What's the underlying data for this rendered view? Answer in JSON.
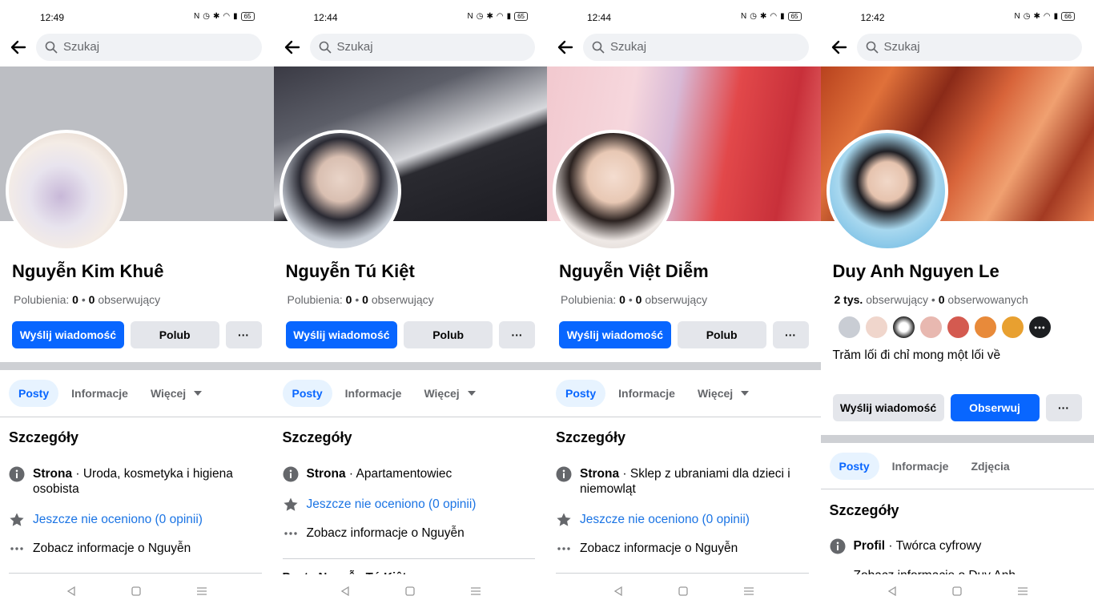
{
  "screens": [
    {
      "time": "12:49",
      "battery": "65",
      "search_placeholder": "Szukaj",
      "name": "Nguyễn Kim Khuê",
      "stats": {
        "label1": "Polubienia:",
        "value1": "0",
        "value2": "0",
        "label2": "obserwujący"
      },
      "buttons": {
        "message": "Wyślij wiadomość",
        "like": "Polub",
        "more": "···"
      },
      "tabs": [
        "Posty",
        "Informacje",
        "Więcej"
      ],
      "details_title": "Szczegóły",
      "details": {
        "category_label": "Strona",
        "category_value": " · Uroda, kosmetyka i higiena osobista",
        "rating": "Jeszcze nie oceniono (0 opinii)",
        "info": "Zobacz informacje o Nguyễn"
      }
    },
    {
      "time": "12:44",
      "battery": "65",
      "search_placeholder": "Szukaj",
      "name": "Nguyễn Tú Kiệt",
      "stats": {
        "label1": "Polubienia:",
        "value1": "0",
        "value2": "0",
        "label2": "obserwujący"
      },
      "buttons": {
        "message": "Wyślij wiadomość",
        "like": "Polub",
        "more": "···"
      },
      "tabs": [
        "Posty",
        "Informacje",
        "Więcej"
      ],
      "details_title": "Szczegóły",
      "details": {
        "category_label": "Strona",
        "category_value": " · Apartamentowiec",
        "rating": "Jeszcze nie oceniono (0 opinii)",
        "info": "Zobacz informacje o Nguyễn"
      },
      "partial_heading": "Posty Nguyễn Tú Kiệt"
    },
    {
      "time": "12:44",
      "battery": "65",
      "search_placeholder": "Szukaj",
      "name": "Nguyễn Việt Diễm",
      "stats": {
        "label1": "Polubienia:",
        "value1": "0",
        "value2": "0",
        "label2": "obserwujący"
      },
      "buttons": {
        "message": "Wyślij wiadomość",
        "like": "Polub",
        "more": "···"
      },
      "tabs": [
        "Posty",
        "Informacje",
        "Więcej"
      ],
      "details_title": "Szczegóły",
      "details": {
        "category_label": "Strona",
        "category_value": " · Sklep z ubraniami dla dzieci i niemowląt",
        "rating": "Jeszcze nie oceniono (0 opinii)",
        "info": "Zobacz informacje o Nguyễn"
      }
    },
    {
      "time": "12:42",
      "battery": "66",
      "search_placeholder": "Szukaj",
      "name": "Duy Anh Nguyen Le",
      "stats": {
        "value1": "2 tys.",
        "label1": "obserwujący",
        "value2": "0",
        "label2": "obserwowanych"
      },
      "bio": "Trăm lối đi chỉ mong một lối về",
      "buttons": {
        "message": "Wyślij wiadomość",
        "follow": "Obserwuj",
        "more": "···"
      },
      "tabs": [
        "Posty",
        "Informacje",
        "Zdjęcia"
      ],
      "details_title": "Szczegóły",
      "details": {
        "category_label": "Profil",
        "category_value": " · Twórca cyfrowy",
        "info": "Zobacz informacje o Duy Anh"
      }
    }
  ],
  "colors": {
    "primary": "#0866ff",
    "secondary_bg": "#e4e6eb",
    "link": "#1b74e4",
    "tab_active_bg": "#e7f3ff",
    "muted_text": "#65676b",
    "divider": "#ced0d4"
  },
  "icons": [
    "back-arrow-icon",
    "search-icon",
    "info-icon",
    "star-icon",
    "more-dots-icon",
    "caret-down-icon",
    "nav-back-icon",
    "nav-home-icon",
    "nav-menu-icon"
  ]
}
